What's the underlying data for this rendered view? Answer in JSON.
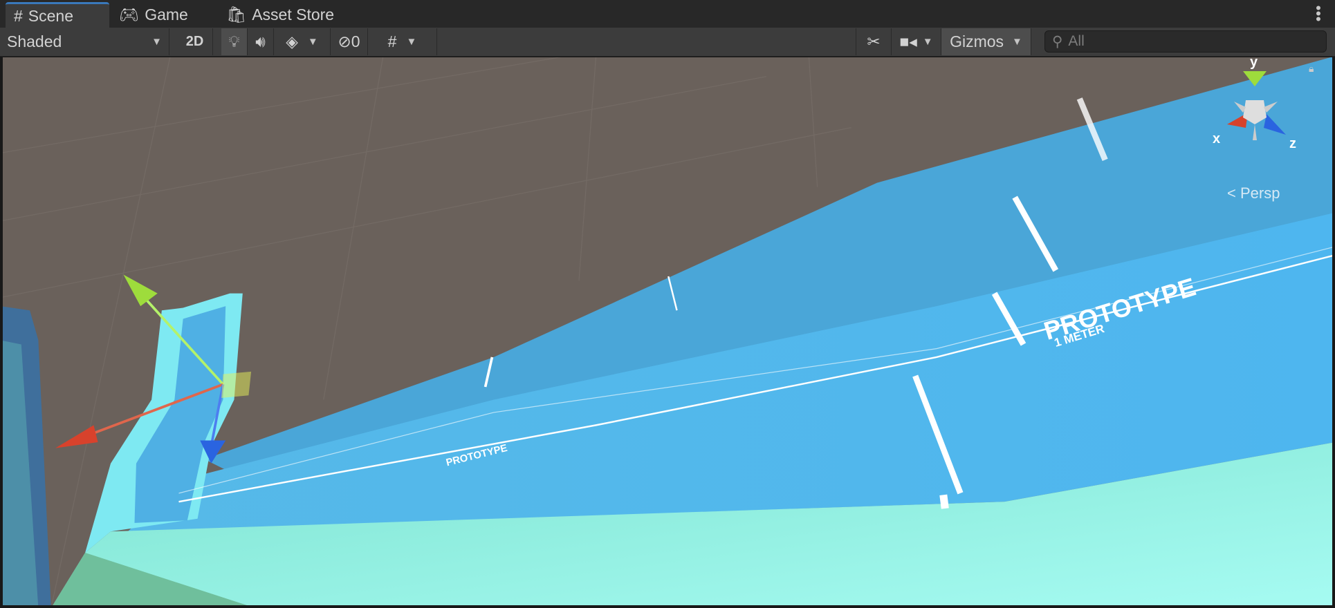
{
  "tabs": [
    {
      "label": "Scene",
      "icon": "hash-icon",
      "active": true
    },
    {
      "label": "Game",
      "icon": "gamepad-icon"
    },
    {
      "label": "Asset Store",
      "icon": "shopping-bag-icon"
    }
  ],
  "toolbar": {
    "draw_mode": "Shaded",
    "mode_2d": "2D",
    "hidden_count": "0",
    "gizmos": "Gizmos",
    "search_placeholder": "All"
  },
  "viewport": {
    "projection": "Persp",
    "track_label": "PROTOTYPE",
    "track_sub": "1 METER",
    "axes": {
      "x": "x",
      "y": "y",
      "z": "z"
    }
  },
  "colors": {
    "accent": "#3a79bb",
    "axis_x": "#d8422c",
    "axis_y": "#9edc3c",
    "axis_z": "#2a64e0"
  }
}
